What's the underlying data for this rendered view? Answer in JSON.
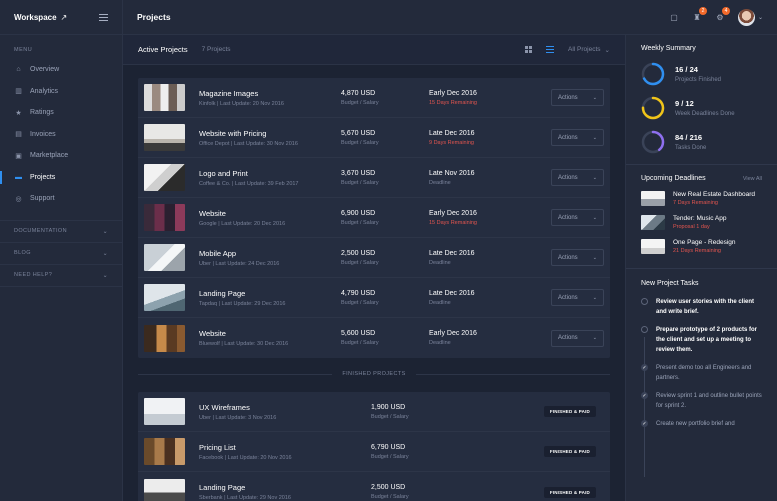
{
  "sidebar": {
    "brand": "Workspace",
    "menu_label": "MENU",
    "items": [
      {
        "label": "Overview",
        "icon": "home-icon"
      },
      {
        "label": "Analytics",
        "icon": "bar-chart-icon"
      },
      {
        "label": "Ratings",
        "icon": "star-icon"
      },
      {
        "label": "Invoices",
        "icon": "invoice-icon"
      },
      {
        "label": "Marketplace",
        "icon": "marketplace-icon"
      },
      {
        "label": "Projects",
        "icon": "chat-icon",
        "active": true
      },
      {
        "label": "Support",
        "icon": "lifebuoy-icon"
      }
    ],
    "sections": [
      {
        "label": "DOCUMENTATION"
      },
      {
        "label": "BLOG"
      },
      {
        "label": "NEED HELP?"
      }
    ]
  },
  "topbar": {
    "title": "Projects",
    "badges": {
      "notifications": "2",
      "messages": "4"
    }
  },
  "main": {
    "title": "Active Projects",
    "count": "7 Projects",
    "filter": "All Projects",
    "actions_label": "Actions",
    "finished_label": "FINISHED PROJECTS",
    "finished_badge": "FINISHED & PAID",
    "active": [
      {
        "name": "Magazine Images",
        "client": "Kinfolk",
        "update": "Last Update: 20 Nov 2016",
        "amount": "4,870 USD",
        "amount_label": "Budget / Salary",
        "due": "Early Dec 2016",
        "due_note": "15 Days Remaining",
        "note_class": "red"
      },
      {
        "name": "Website with Pricing",
        "client": "Office Depot",
        "update": "Last Update: 30 Nov 2016",
        "amount": "5,670 USD",
        "amount_label": "Budget / Salary",
        "due": "Late Dec 2016",
        "due_note": "9 Days Remaining",
        "note_class": "red"
      },
      {
        "name": "Logo and Print",
        "client": "Coffee & Co.",
        "update": "Last Update: 39 Feb 2017",
        "amount": "3,670 USD",
        "amount_label": "Budget / Salary",
        "due": "Late Nov 2016",
        "due_note": "Deadline",
        "note_class": "grey"
      },
      {
        "name": "Website",
        "client": "Google",
        "update": "Last Update: 20 Dec 2016",
        "amount": "6,900 USD",
        "amount_label": "Budget / Salary",
        "due": "Early Dec 2016",
        "due_note": "15 Days Remaining",
        "note_class": "red"
      },
      {
        "name": "Mobile App",
        "client": "Uber",
        "update": "Last Update: 24 Dec 2016",
        "amount": "2,500 USD",
        "amount_label": "Budget / Salary",
        "due": "Late Dec 2016",
        "due_note": "Deadline",
        "note_class": "grey"
      },
      {
        "name": "Landing Page",
        "client": "Tapdaq",
        "update": "Last Update: 29 Dec 2016",
        "amount": "4,790 USD",
        "amount_label": "Budget / Salary",
        "due": "Late Dec 2016",
        "due_note": "Deadline",
        "note_class": "grey"
      },
      {
        "name": "Website",
        "client": "Bluewolf",
        "update": "Last Update: 30 Dec 2016",
        "amount": "5,600 USD",
        "amount_label": "Budget / Salary",
        "due": "Early Dec 2016",
        "due_note": "Deadline",
        "note_class": "grey"
      }
    ],
    "finished": [
      {
        "name": "UX Wireframes",
        "client": "Uber",
        "update": "Last Update: 3 Nov 2016",
        "amount": "1,900 USD",
        "amount_label": "Budget / Salary"
      },
      {
        "name": "Pricing List",
        "client": "Facebook",
        "update": "Last Update: 20 Nov 2016",
        "amount": "6,790 USD",
        "amount_label": "Budget / Salary"
      },
      {
        "name": "Landing Page",
        "client": "Sberbank",
        "update": "Last Update: 29 Nov 2016",
        "amount": "2,500 USD",
        "amount_label": "Budget / Salary"
      }
    ]
  },
  "weekly": {
    "title": "Weekly Summary",
    "stats": [
      {
        "value": "16 / 24",
        "label": "Projects Finished",
        "color": "#2f8ff0",
        "fraction": 0.67
      },
      {
        "value": "9 / 12",
        "label": "Week Deadlines Done",
        "color": "#f0c419",
        "fraction": 0.75
      },
      {
        "value": "84 / 216",
        "label": "Tasks Done",
        "color": "#8e6ff0",
        "fraction": 0.39
      }
    ]
  },
  "upcoming": {
    "title": "Upcoming Deadlines",
    "view_all": "View All",
    "items": [
      {
        "name": "New Real Estate Dashboard",
        "note": "7 Days Remaining"
      },
      {
        "name": "Tender: Music App",
        "note": "Proposal 1 day"
      },
      {
        "name": "One Page - Redesign",
        "note": "21 Days Remaining"
      }
    ]
  },
  "tasks": {
    "title": "New Project Tasks",
    "items": [
      {
        "text": "Review user stories with the client and write brief.",
        "done": false
      },
      {
        "text": "Prepare prototype of 2 products for the client and set up a meeting to review them.",
        "done": false
      },
      {
        "text": "Present demo too all Engineers and partners.",
        "done": true
      },
      {
        "text": "Review sprint 1 and outline bullet points for sprint 2.",
        "done": true
      },
      {
        "text": "Create new portfolio brief and",
        "done": true
      }
    ]
  }
}
